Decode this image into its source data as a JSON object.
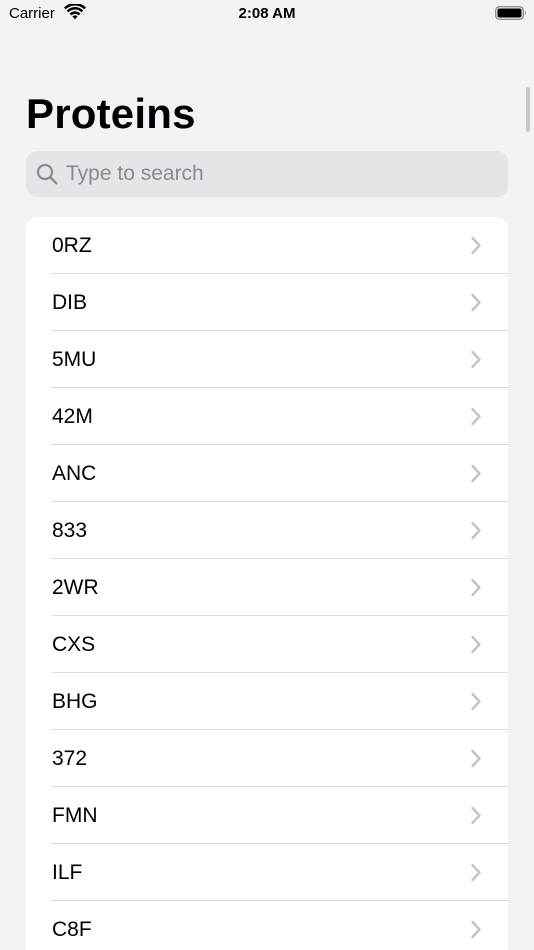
{
  "status_bar": {
    "carrier": "Carrier",
    "time": "2:08 AM"
  },
  "header": {
    "title": "Proteins"
  },
  "search": {
    "placeholder": "Type to search",
    "value": ""
  },
  "icons": {
    "search": "magnifying-glass-icon",
    "row_disclosure": "chevron-right-icon",
    "wifi": "wifi-icon",
    "battery": "battery-icon"
  },
  "colors": {
    "background": "#f2f2f7",
    "search_fill": "#e4e4e9",
    "placeholder": "#8a8a8f",
    "chevron": "#c4c4c7",
    "separator": "#dcdce0"
  },
  "proteins": [
    {
      "label": "0RZ"
    },
    {
      "label": "DIB"
    },
    {
      "label": "5MU"
    },
    {
      "label": "42M"
    },
    {
      "label": "ANC"
    },
    {
      "label": "833"
    },
    {
      "label": "2WR"
    },
    {
      "label": "CXS"
    },
    {
      "label": "BHG"
    },
    {
      "label": "372"
    },
    {
      "label": "FMN"
    },
    {
      "label": "ILF"
    },
    {
      "label": "C8F"
    }
  ]
}
